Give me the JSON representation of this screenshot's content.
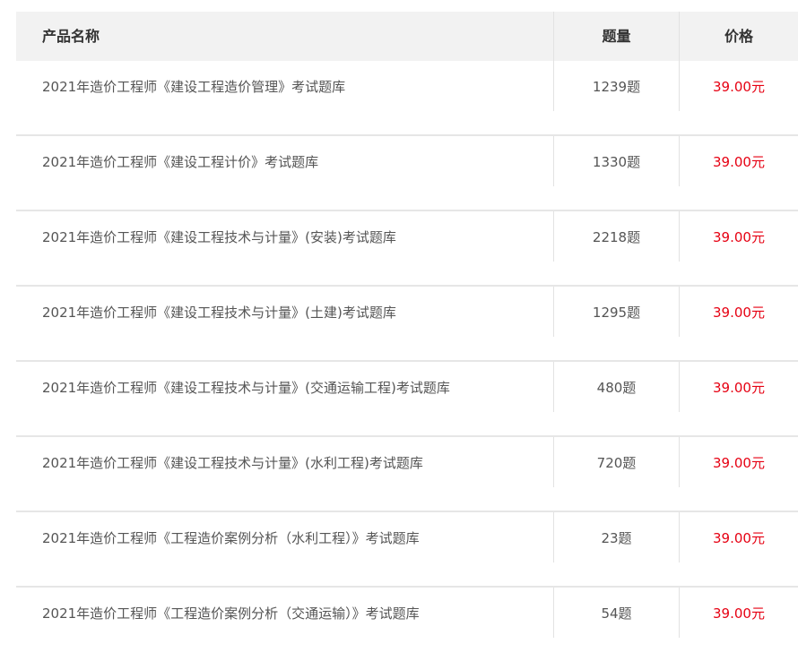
{
  "table": {
    "headers": {
      "name": "产品名称",
      "qty": "题量",
      "price": "价格"
    },
    "colors": {
      "price": "#e60012",
      "header_bg": "#f2f2f2",
      "text": "#555555"
    },
    "rows": [
      {
        "name": "2021年造价工程师《建设工程造价管理》考试题库",
        "qty": "1239题",
        "price": "39.00元"
      },
      {
        "name": "2021年造价工程师《建设工程计价》考试题库",
        "qty": "1330题",
        "price": "39.00元"
      },
      {
        "name": "2021年造价工程师《建设工程技术与计量》(安装)考试题库",
        "qty": "2218题",
        "price": "39.00元"
      },
      {
        "name": "2021年造价工程师《建设工程技术与计量》(土建)考试题库",
        "qty": "1295题",
        "price": "39.00元"
      },
      {
        "name": "2021年造价工程师《建设工程技术与计量》(交通运输工程)考试题库",
        "qty": "480题",
        "price": "39.00元"
      },
      {
        "name": "2021年造价工程师《建设工程技术与计量》(水利工程)考试题库",
        "qty": "720题",
        "price": "39.00元"
      },
      {
        "name": "2021年造价工程师《工程造价案例分析（水利工程）》考试题库",
        "qty": "23题",
        "price": "39.00元"
      },
      {
        "name": "2021年造价工程师《工程造价案例分析（交通运输）》考试题库",
        "qty": "54题",
        "price": "39.00元"
      }
    ]
  }
}
